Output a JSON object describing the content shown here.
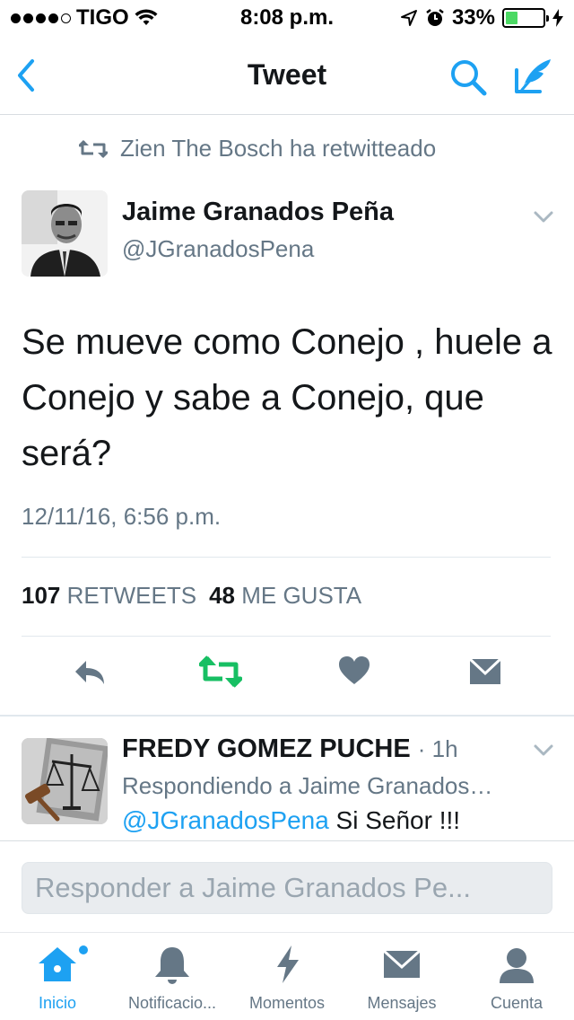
{
  "status_bar": {
    "carrier": "TIGO",
    "time": "8:08 p.m.",
    "battery": "33%",
    "battery_level": 0.33
  },
  "nav": {
    "title": "Tweet"
  },
  "retweet_context": {
    "text": "Zien The Bosch ha retwitteado"
  },
  "tweet": {
    "author_name": "Jaime Granados Peña",
    "author_handle": "@JGranadosPena",
    "text": "Se mueve como Conejo , huele a Conejo y sabe a Conejo, que será?",
    "timestamp": "12/11/16, 6:56 p.m.",
    "retweet_count": "107",
    "retweet_label": "RETWEETS",
    "like_count": "48",
    "like_label": "ME GUSTA"
  },
  "reply": {
    "author_name": "FREDY  GOMEZ PUCHE",
    "time_ago": "· 1h",
    "context": "Respondiendo a Jaime Granados…",
    "mention": "@JGranadosPena",
    "text": " Si Señor !!!"
  },
  "composer": {
    "placeholder": "Responder a Jaime Granados Pe..."
  },
  "tabbar": {
    "items": [
      {
        "label": "Inicio",
        "icon": "home-icon",
        "active": true
      },
      {
        "label": "Notificacio...",
        "icon": "bell-icon",
        "active": false
      },
      {
        "label": "Momentos",
        "icon": "lightning-icon",
        "active": false
      },
      {
        "label": "Mensajes",
        "icon": "envelope-icon",
        "active": false
      },
      {
        "label": "Cuenta",
        "icon": "person-icon",
        "active": false
      }
    ]
  },
  "colors": {
    "accent": "#1da1f2",
    "muted": "#657786",
    "retweet_green": "#17bf63",
    "icon_gray": "#657786",
    "battery_green": "#4cd964"
  }
}
